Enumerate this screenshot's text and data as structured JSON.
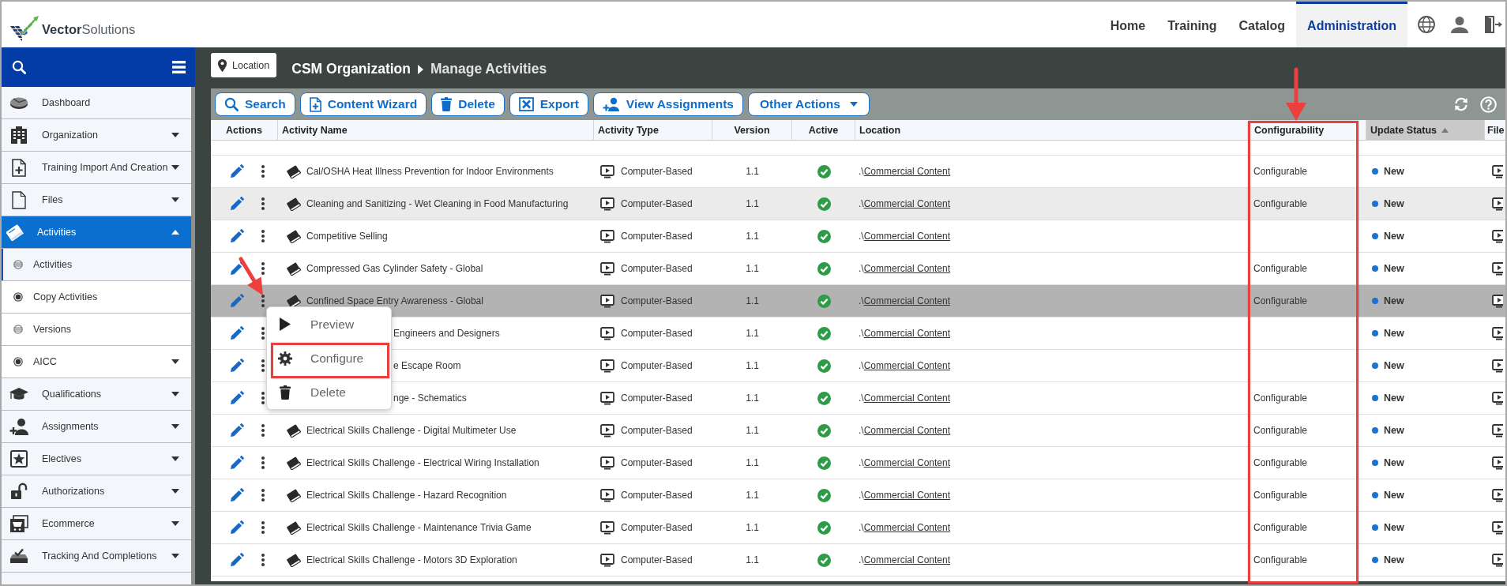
{
  "brand": {
    "logo_text": "**Vector**Solutions"
  },
  "top_nav": [
    {
      "label": "Home",
      "selected": false
    },
    {
      "label": "Training",
      "selected": false
    },
    {
      "label": "Catalog",
      "selected": false
    },
    {
      "label": "Administration",
      "selected": true
    }
  ],
  "sidebar": {
    "items": [
      {
        "label": "Dashboard",
        "selected": false
      },
      {
        "label": "Organization",
        "selected": false,
        "expanded": false
      },
      {
        "label": "Training Import And Creation",
        "selected": false,
        "expanded": false
      },
      {
        "label": "Files",
        "selected": false,
        "expanded": false
      },
      {
        "label": "Activities",
        "selected": true,
        "expanded": true,
        "children": [
          {
            "label": "Activities",
            "selected": true
          },
          {
            "label": "Copy Activities",
            "selected": false
          },
          {
            "label": "Versions",
            "selected": false
          },
          {
            "label": "AICC",
            "selected": false,
            "expanded": false
          }
        ]
      },
      {
        "label": "Qualifications",
        "selected": false,
        "expanded": false
      },
      {
        "label": "Assignments",
        "selected": false,
        "expanded": false
      },
      {
        "label": "Electives",
        "selected": false,
        "expanded": false
      },
      {
        "label": "Authorizations",
        "selected": false,
        "expanded": false
      },
      {
        "label": "Ecommerce",
        "selected": false,
        "expanded": false
      },
      {
        "label": "Tracking And Completions",
        "selected": false,
        "expanded": false
      }
    ]
  },
  "page_header": {
    "location_button": "Location",
    "breadcrumb": [
      "CSM Organization",
      "Manage Activities"
    ]
  },
  "toolbar": {
    "buttons": [
      {
        "label": "Search",
        "kind": "action"
      },
      {
        "label": "Content Wizard",
        "kind": "action"
      },
      {
        "label": "Delete",
        "kind": "action"
      },
      {
        "label": "Export",
        "kind": "action"
      },
      {
        "label": "View Assignments",
        "kind": "action"
      },
      {
        "label": "Other Actions",
        "kind": "dropdown"
      }
    ]
  },
  "table": {
    "columns": [
      {
        "label": "Actions",
        "sorted": false,
        "annotated": false
      },
      {
        "label": "Activity Name",
        "sorted": false,
        "annotated": false
      },
      {
        "label": "Activity Type",
        "sorted": false,
        "annotated": false
      },
      {
        "label": "Version",
        "sorted": false,
        "annotated": false
      },
      {
        "label": "Active",
        "sorted": false,
        "annotated": false
      },
      {
        "label": "Location",
        "sorted": false,
        "annotated": false
      },
      {
        "label": "Configurability",
        "sorted": false,
        "annotated": true
      },
      {
        "label": "Update Status",
        "sorted": true,
        "annotated": false
      },
      {
        "label": "File",
        "sorted": false,
        "annotated": false
      }
    ],
    "rows": [
      {
        "name": "Cal/OSHA Heat Illness Prevention for Indoor Environments",
        "type": "Computer-Based",
        "version": "1.1",
        "active": true,
        "location_prefix": ".\\",
        "location": "Commercial Content",
        "configurability": "Configurable",
        "update_status": "New",
        "selected": false,
        "hovered": false
      },
      {
        "name": "Cleaning and Sanitizing - Wet Cleaning in Food Manufacturing",
        "type": "Computer-Based",
        "version": "1.1",
        "active": true,
        "location_prefix": ".\\",
        "location": "Commercial Content",
        "configurability": "Configurable",
        "update_status": "New",
        "selected": false,
        "hovered": true
      },
      {
        "name": "Competitive Selling",
        "type": "Computer-Based",
        "version": "1.1",
        "active": true,
        "location_prefix": ".\\",
        "location": "Commercial Content",
        "update_status": "New",
        "selected": false,
        "hovered": false
      },
      {
        "name": "Compressed Gas Cylinder Safety - Global",
        "type": "Computer-Based",
        "version": "1.1",
        "active": true,
        "location_prefix": ".\\",
        "location": "Commercial Content",
        "configurability": "Configurable",
        "update_status": "New",
        "selected": false,
        "hovered": false
      },
      {
        "name": "Confined Space Entry Awareness - Global",
        "type": "Computer-Based",
        "version": "1.1",
        "active": true,
        "location_prefix": ".\\",
        "location": "Commercial Content",
        "configurability": "Configurable",
        "update_status": "New",
        "selected": true,
        "hovered": false
      },
      {
        "name": "Engineers and Designers",
        "type": "Computer-Based",
        "version": "1.1",
        "active": true,
        "location_prefix": ".\\",
        "location": "Commercial Content",
        "update_status": "New",
        "selected": false,
        "hovered": false
      },
      {
        "name": "e Escape Room",
        "type": "Computer-Based",
        "version": "1.1",
        "active": true,
        "location_prefix": ".\\",
        "location": "Commercial Content",
        "update_status": "New",
        "selected": false,
        "hovered": false
      },
      {
        "name": "nge - Schematics",
        "type": "Computer-Based",
        "version": "1.1",
        "active": true,
        "location_prefix": ".\\",
        "location": "Commercial Content",
        "configurability": "Configurable",
        "update_status": "New",
        "selected": false,
        "hovered": false
      },
      {
        "name": "Electrical Skills Challenge - Digital Multimeter Use",
        "type": "Computer-Based",
        "version": "1.1",
        "active": true,
        "location_prefix": ".\\",
        "location": "Commercial Content",
        "configurability": "Configurable",
        "update_status": "New",
        "selected": false,
        "hovered": false
      },
      {
        "name": "Electrical Skills Challenge - Electrical Wiring Installation",
        "type": "Computer-Based",
        "version": "1.1",
        "active": true,
        "location_prefix": ".\\",
        "location": "Commercial Content",
        "configurability": "Configurable",
        "update_status": "New",
        "selected": false,
        "hovered": false
      },
      {
        "name": "Electrical Skills Challenge - Hazard Recognition",
        "type": "Computer-Based",
        "version": "1.1",
        "active": true,
        "location_prefix": ".\\",
        "location": "Commercial Content",
        "configurability": "Configurable",
        "update_status": "New",
        "selected": false,
        "hovered": false
      },
      {
        "name": "Electrical Skills Challenge - Maintenance Trivia Game",
        "type": "Computer-Based",
        "version": "1.1",
        "active": true,
        "location_prefix": ".\\",
        "location": "Commercial Content",
        "configurability": "Configurable",
        "update_status": "New",
        "selected": false,
        "hovered": false
      },
      {
        "name": "Electrical Skills Challenge - Motors 3D Exploration",
        "type": "Computer-Based",
        "version": "1.1",
        "active": true,
        "location_prefix": ".\\",
        "location": "Commercial Content",
        "configurability": "Configurable",
        "update_status": "New",
        "selected": false,
        "hovered": false
      }
    ],
    "context_menu": {
      "trigger_annotated": true,
      "items": [
        {
          "label": "Preview",
          "annotated": false
        },
        {
          "label": "Configure",
          "annotated": true
        },
        {
          "label": "Delete",
          "annotated": false
        }
      ]
    }
  }
}
